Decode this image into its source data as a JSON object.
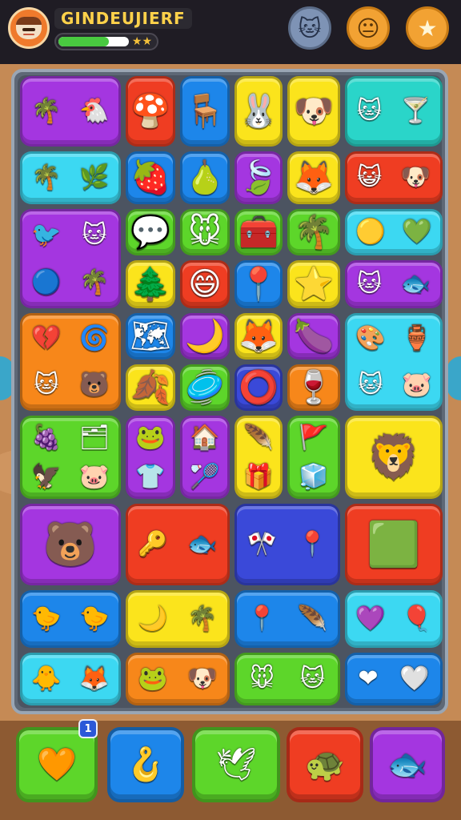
{
  "header": {
    "title": "GINDEUJIERF",
    "progress_fraction": 0.72,
    "progress_stars": "★★",
    "avatar_icon": "player-avatar",
    "buttons": [
      {
        "name": "cat-face-button",
        "glyph": "🐱"
      },
      {
        "name": "mask-face-button",
        "glyph": "😐"
      },
      {
        "name": "star-button",
        "glyph": "★"
      }
    ]
  },
  "board": {
    "tiles": [
      {
        "color": "purple",
        "icons": [
          "🌴",
          "🐔"
        ]
      },
      {
        "color": "red",
        "icons": [
          "🍄"
        ]
      },
      {
        "color": "blue",
        "icons": [
          "🪑"
        ]
      },
      {
        "color": "yellow",
        "icons": [
          "🐰"
        ]
      },
      {
        "color": "yellow",
        "icons": [
          "🐶"
        ]
      },
      {
        "color": "teal",
        "icons": [
          "🐱",
          "🍸"
        ]
      },
      {
        "color": "cyan",
        "icons": [
          "🌴",
          "🌿"
        ]
      },
      {
        "color": "blue",
        "icons": [
          "🍓"
        ]
      },
      {
        "color": "blue",
        "icons": [
          "🍐"
        ]
      },
      {
        "color": "purple",
        "icons": [
          "🍃"
        ]
      },
      {
        "color": "yellow",
        "icons": [
          "🦊"
        ]
      },
      {
        "color": "red",
        "icons": [
          "😺",
          "🐶"
        ]
      },
      {
        "color": "purple",
        "icons": [
          "🐦",
          "🐱",
          "🔵",
          "🌴"
        ]
      },
      {
        "color": "green",
        "icons": [
          "💬"
        ]
      },
      {
        "color": "green",
        "icons": [
          "🐭"
        ]
      },
      {
        "color": "green",
        "icons": [
          "🧰"
        ]
      },
      {
        "color": "green",
        "icons": [
          "🌴"
        ]
      },
      {
        "color": "cyan",
        "icons": [
          "🟡",
          "💚"
        ]
      },
      {
        "color": "yellow",
        "icons": [
          "🌲"
        ]
      },
      {
        "color": "red",
        "icons": [
          "😄"
        ]
      },
      {
        "color": "blue",
        "icons": [
          "📍"
        ]
      },
      {
        "color": "yellow",
        "icons": [
          "⭐"
        ]
      },
      {
        "color": "purple",
        "icons": [
          "🐱",
          "🐟"
        ]
      },
      {
        "color": "orange",
        "icons": [
          "💔",
          "🌀",
          "🐱",
          "🐻"
        ]
      },
      {
        "color": "blue",
        "icons": [
          "🗺"
        ]
      },
      {
        "color": "purple",
        "icons": [
          "🌙"
        ]
      },
      {
        "color": "yellow",
        "icons": [
          "🦊"
        ]
      },
      {
        "color": "purple",
        "icons": [
          "🍆"
        ]
      },
      {
        "color": "cyan",
        "icons": [
          "🎨",
          "🏺",
          "🐱",
          "🐷"
        ]
      },
      {
        "color": "yellow",
        "icons": [
          "🍂"
        ]
      },
      {
        "color": "green",
        "icons": [
          "🥏"
        ]
      },
      {
        "color": "navy",
        "icons": [
          "⭕"
        ]
      },
      {
        "color": "orange",
        "icons": [
          "🍷"
        ]
      },
      {
        "color": "green",
        "icons": [
          "🍇",
          "🗂",
          "🦅",
          "🐷"
        ]
      },
      {
        "color": "purple",
        "icons": [
          "🐸",
          "👕"
        ]
      },
      {
        "color": "purple",
        "icons": [
          "🏠",
          "🏸"
        ]
      },
      {
        "color": "yellow",
        "icons": [
          "🪶",
          "🎁"
        ]
      },
      {
        "color": "green",
        "icons": [
          "🚩",
          "🧊"
        ]
      },
      {
        "color": "yellow",
        "icons": [
          "🦁"
        ]
      },
      {
        "color": "purple",
        "icons": [
          "🐻"
        ]
      },
      {
        "color": "red",
        "icons": [
          "🔑",
          "🐟"
        ]
      },
      {
        "color": "navy",
        "icons": [
          "🎌",
          "📍"
        ]
      },
      {
        "color": "red",
        "icons": [
          "🟩"
        ]
      },
      {
        "color": "blue",
        "icons": [
          "🐤",
          "🐤"
        ]
      },
      {
        "color": "yellow",
        "icons": [
          "🌙",
          "🌴"
        ]
      },
      {
        "color": "blue",
        "icons": [
          "📍",
          "🪶"
        ]
      },
      {
        "color": "cyan",
        "icons": [
          "💜",
          "🎈"
        ]
      },
      {
        "color": "cyan",
        "icons": [
          "🐥",
          "🦊"
        ]
      },
      {
        "color": "orange",
        "icons": [
          "🐸",
          "🐶"
        ]
      },
      {
        "color": "green",
        "icons": [
          "🐭",
          "🐱"
        ]
      },
      {
        "color": "blue",
        "icons": [
          "❤",
          "🤍"
        ]
      }
    ]
  },
  "tray": {
    "badge": "1",
    "tiles": [
      {
        "color": "green",
        "icon": "🧡"
      },
      {
        "color": "blue",
        "icon": "🪝"
      },
      {
        "color": "green",
        "icon": "🕊"
      },
      {
        "color": "red",
        "icon": "🐢"
      },
      {
        "color": "purple",
        "icon": "🐟"
      }
    ]
  }
}
